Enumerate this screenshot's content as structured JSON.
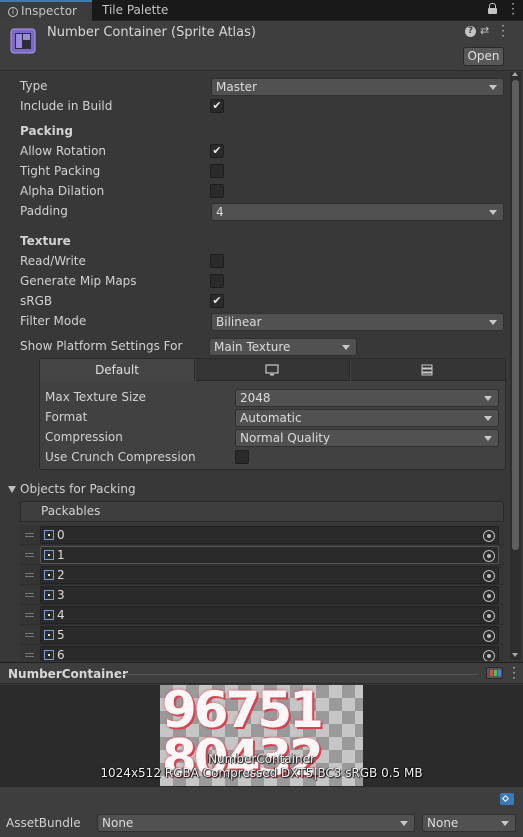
{
  "tabs": [
    {
      "label": "Inspector",
      "icon": "info-icon"
    },
    {
      "label": "Tile Palette"
    }
  ],
  "asset_title": "Number Container (Sprite Atlas)",
  "open_button": "Open",
  "fields": {
    "type_label": "Type",
    "type_value": "Master",
    "include_label": "Include in Build",
    "include_checked": true,
    "packing_header": "Packing",
    "allow_rotation_label": "Allow Rotation",
    "allow_rotation_checked": true,
    "tight_packing_label": "Tight Packing",
    "tight_packing_checked": false,
    "alpha_dilation_label": "Alpha Dilation",
    "alpha_dilation_checked": false,
    "padding_label": "Padding",
    "padding_value": "4",
    "texture_header": "Texture",
    "readwrite_label": "Read/Write",
    "readwrite_checked": false,
    "mipmaps_label": "Generate Mip Maps",
    "mipmaps_checked": false,
    "srgb_label": "sRGB",
    "srgb_checked": true,
    "filter_label": "Filter Mode",
    "filter_value": "Bilinear",
    "platform_label": "Show Platform Settings For",
    "platform_value": "Main Texture"
  },
  "platform_tabs": {
    "default_label": "Default",
    "icons": [
      "monitor-icon",
      "grid-icon"
    ]
  },
  "platform_settings": {
    "max_size_label": "Max Texture Size",
    "max_size_value": "2048",
    "format_label": "Format",
    "format_value": "Automatic",
    "compression_label": "Compression",
    "compression_value": "Normal Quality",
    "crunch_label": "Use Crunch Compression",
    "crunch_checked": false
  },
  "objects_header": "Objects for Packing",
  "packables_header": "Packables",
  "packables": [
    "0",
    "1",
    "2",
    "3",
    "4",
    "5",
    "6"
  ],
  "preview": {
    "title": "NumberContainer",
    "sprite_label": "NumberContainer",
    "info": "1024x512 RGBA Compressed DXT5|BC3 sRGB   0.5 MB",
    "digits_row1": "96751",
    "digits_row2": "80432"
  },
  "assetbundle": {
    "label": "AssetBundle",
    "name_value": "None",
    "variant_value": "None"
  },
  "checkmark": "✔"
}
